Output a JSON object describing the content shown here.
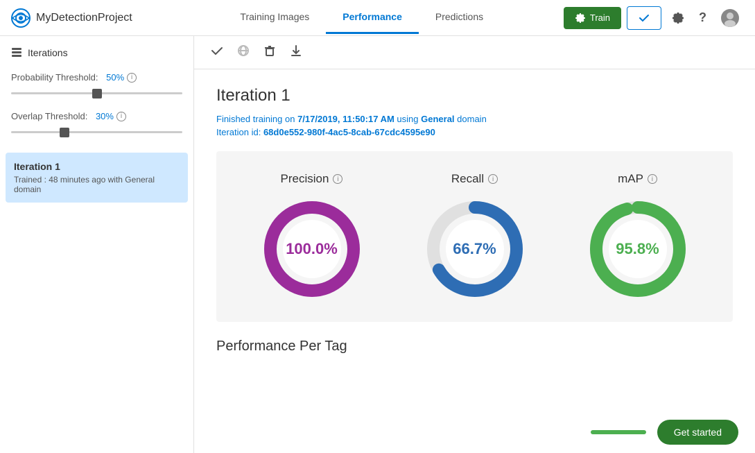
{
  "header": {
    "project_name": "MyDetectionProject",
    "nav_tabs": [
      {
        "id": "training-images",
        "label": "Training Images",
        "active": false
      },
      {
        "id": "performance",
        "label": "Performance",
        "active": true
      },
      {
        "id": "predictions",
        "label": "Predictions",
        "active": false
      }
    ],
    "btn_train_label": "Train",
    "btn_check_label": "✓",
    "settings_icon": "⚙",
    "help_icon": "?",
    "user_icon": "👤"
  },
  "sidebar": {
    "header_label": "Iterations",
    "probability_threshold_label": "Probability Threshold:",
    "probability_threshold_value": "50%",
    "overlap_threshold_label": "Overlap Threshold:",
    "overlap_threshold_value": "30%",
    "info_icon_label": "i",
    "iteration_item": {
      "title": "Iteration 1",
      "description": "Trained : 48 minutes ago with General domain"
    }
  },
  "toolbar": {
    "check_icon": "✓",
    "globe_icon": "🌐",
    "delete_icon": "🗑",
    "download_icon": "⬇"
  },
  "content": {
    "iteration_title": "Iteration 1",
    "training_info": "Finished training on 7/17/2019, 11:50:17 AM using General domain",
    "training_date_bold": "7/17/2019, 11:50:17 AM",
    "training_domain_bold": "General",
    "iteration_id_label": "Iteration id:",
    "iteration_id_value": "68d0e552-980f-4ac5-8cab-67cdc4595e90",
    "metrics": [
      {
        "id": "precision",
        "label": "Precision",
        "value": "100.0%",
        "percent": 100,
        "color": "#9b2c9b",
        "text_color": "#9b2c9b"
      },
      {
        "id": "recall",
        "label": "Recall",
        "value": "66.7%",
        "percent": 66.7,
        "color": "#2e6db4",
        "text_color": "#2e6db4"
      },
      {
        "id": "map",
        "label": "mAP",
        "value": "95.8%",
        "percent": 95.8,
        "color": "#4caf50",
        "text_color": "#4caf50"
      }
    ],
    "performance_per_tag_label": "Performance Per Tag",
    "get_started_label": "Get started"
  },
  "icons": {
    "eye_color": "#0078d4",
    "train_gear": "⚙"
  }
}
